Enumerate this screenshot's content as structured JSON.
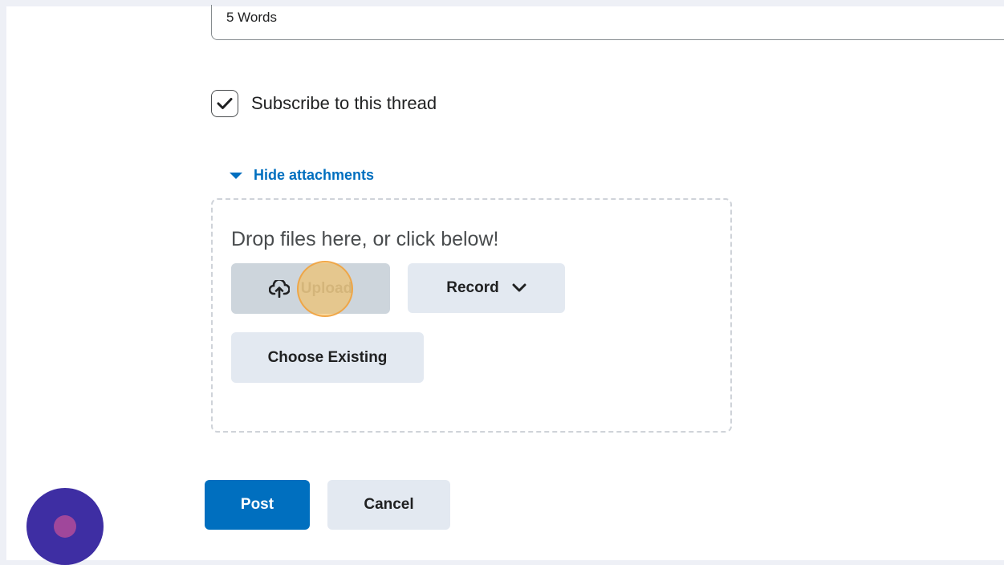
{
  "word_count": {
    "text": "5 Words"
  },
  "subscribe": {
    "label": "Subscribe to this thread",
    "checked": true
  },
  "attachments": {
    "toggle_label": "Hide attachments",
    "drop_text": "Drop files here, or click below!",
    "upload_label": "Upload",
    "record_label": "Record",
    "choose_existing_label": "Choose Existing"
  },
  "actions": {
    "post_label": "Post",
    "cancel_label": "Cancel"
  },
  "icons": {
    "checkbox": "checkmark-icon",
    "toggle": "caret-down-icon",
    "upload": "cloud-upload-icon",
    "record": "chevron-down-icon",
    "fab": "assistant-icon"
  },
  "colors": {
    "link": "#006fbf",
    "primary_button": "#006fbf",
    "secondary_button": "#e3e9f1",
    "upload_button_active": "#cdd5dc",
    "fab": "#3e2ea3",
    "click_marker": "#f5be5a"
  }
}
